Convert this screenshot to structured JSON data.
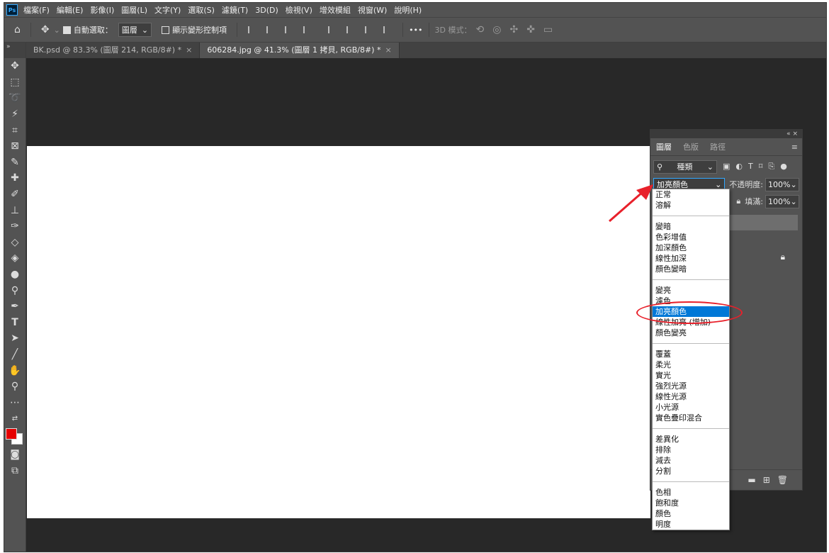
{
  "menubar": {
    "logo": "Ps",
    "items": [
      "檔案(F)",
      "編輯(E)",
      "影像(I)",
      "圖層(L)",
      "文字(Y)",
      "選取(S)",
      "濾鏡(T)",
      "3D(D)",
      "檢視(V)",
      "增效模組",
      "視窗(W)",
      "說明(H)"
    ]
  },
  "options": {
    "auto_select_label": "自動選取：",
    "auto_select_value": "圖層",
    "show_transform_label": "顯示變形控制項",
    "more": "•••",
    "mode_3d_label": "3D 模式："
  },
  "tabs": [
    {
      "label": "BK.psd @ 83.3% (圖層 214, RGB/8#) *",
      "close": "×"
    },
    {
      "label": "606284.jpg @ 41.3% (圖層 1 拷貝, RGB/8#) *",
      "close": "×"
    }
  ],
  "layers_panel": {
    "collapse": "«  ×",
    "tabs": [
      "圖層",
      "色版",
      "路徑"
    ],
    "filter_label": "種類",
    "blend_current": "加亮顏色",
    "opacity_label": "不透明度:",
    "opacity_value": "100%",
    "fill_label": "填滿:",
    "fill_value": "100%"
  },
  "blend_menu": {
    "groups": [
      [
        "正常",
        "溶解"
      ],
      [
        "變暗",
        "色彩增值",
        "加深顏色",
        "線性加深",
        "顏色變暗"
      ],
      [
        "變亮",
        "濾色",
        "加亮顏色",
        "線性加亮 (增加)",
        "顏色變亮"
      ],
      [
        "覆蓋",
        "柔光",
        "實光",
        "強烈光源",
        "線性光源",
        "小光源",
        "實色疊印混合"
      ],
      [
        "差異化",
        "排除",
        "減去",
        "分割"
      ],
      [
        "色相",
        "飽和度",
        "顏色",
        "明度"
      ]
    ],
    "selected": "加亮顏色"
  },
  "colors": {
    "foreground": "#e60000",
    "background": "#ffffff",
    "highlight": "#0078d7",
    "annotation": "#e8202a"
  }
}
